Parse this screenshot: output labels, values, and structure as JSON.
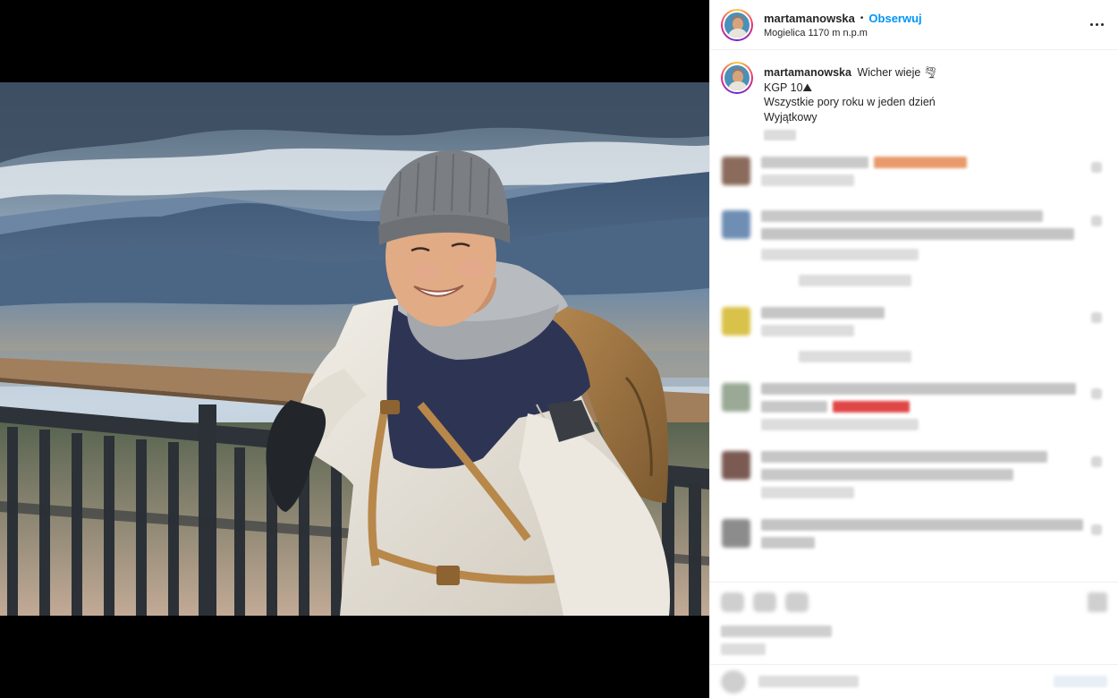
{
  "post": {
    "username": "martamanowska",
    "follow_label": "Obserwuj",
    "dot": "•",
    "location": "Mogielica 1170 m n.p.m",
    "more_icon": "more-horizontal-icon",
    "caption": {
      "username": "martamanowska",
      "line1": "Wicher wieje 🌪",
      "line2": "KGP 10⛰",
      "line3": "Wszystkie pory roku w jeden dzień",
      "line4": "Wyjątkowy"
    }
  },
  "colors": {
    "follow": "#0095f6",
    "text": "#262626",
    "divider": "#efefef",
    "media_bg": "#000000"
  }
}
